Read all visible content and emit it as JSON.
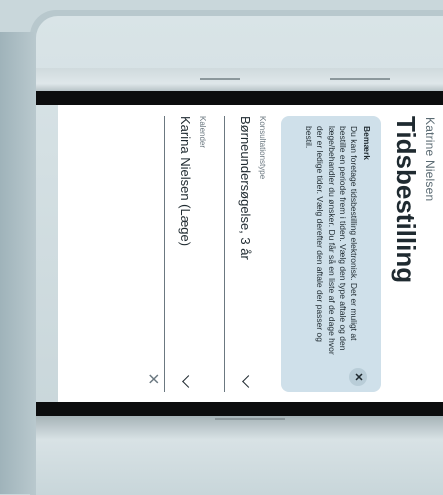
{
  "header": {
    "patient_name": "Katrine Nielsen",
    "title": "Tidsbestilling"
  },
  "note": {
    "heading": "Bemærk",
    "text": "Du kan foretage tidsbestilling elektronisk. Det er muligt at bestille en periode frem i tiden. Vælg den type aftale og den læge/behandler du ønsker. Du får så en liste af de dage hvor der er ledige tider. Vælg derefter den aftale der passer og bestil."
  },
  "fields": {
    "consultation": {
      "label": "Konsultationstype",
      "value": "Børneundersøgelse, 3 år"
    },
    "calendar": {
      "label": "Kalender",
      "value": "Karina Nielsen (Læge)"
    }
  },
  "icons": {
    "close": "close-icon",
    "dismiss_note": "dismiss-icon",
    "chevron": "chevron-down-icon"
  }
}
